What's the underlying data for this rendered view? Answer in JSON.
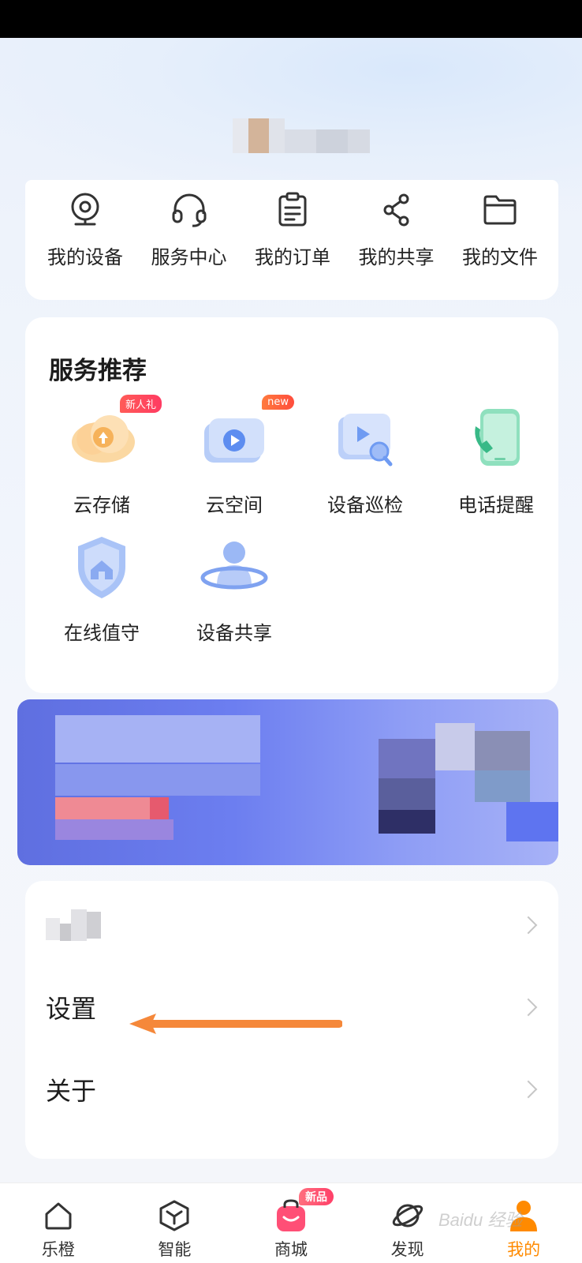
{
  "quick_actions": [
    {
      "label": "我的设备",
      "icon": "camera-icon"
    },
    {
      "label": "服务中心",
      "icon": "headset-icon"
    },
    {
      "label": "我的订单",
      "icon": "order-icon"
    },
    {
      "label": "我的共享",
      "icon": "share-icon"
    },
    {
      "label": "我的文件",
      "icon": "folder-icon"
    }
  ],
  "services": {
    "title": "服务推荐",
    "items": [
      {
        "label": "云存储",
        "badge": "新人礼",
        "icon": "cloud-upload-icon"
      },
      {
        "label": "云空间",
        "badge": "new",
        "icon": "cloud-video-icon"
      },
      {
        "label": "设备巡检",
        "icon": "device-inspection-icon"
      },
      {
        "label": "电话提醒",
        "icon": "phone-icon"
      },
      {
        "label": "在线值守",
        "icon": "shield-home-icon"
      },
      {
        "label": "设备共享",
        "icon": "user-orbit-icon"
      }
    ]
  },
  "menu": {
    "settings_label": "设置",
    "about_label": "关于"
  },
  "tabs": [
    {
      "label": "乐橙",
      "icon": "home-icon"
    },
    {
      "label": "智能",
      "icon": "cube-icon"
    },
    {
      "label": "商城",
      "icon": "shop-bag-icon",
      "badge": "新品"
    },
    {
      "label": "发现",
      "icon": "planet-icon"
    },
    {
      "label": "我的",
      "icon": "user-icon",
      "active": true
    }
  ],
  "colors": {
    "accent": "#ff8a00",
    "annotation_arrow": "#f5883a",
    "badge_red": "#ff3f68"
  },
  "watermark": "Baidu 经验"
}
